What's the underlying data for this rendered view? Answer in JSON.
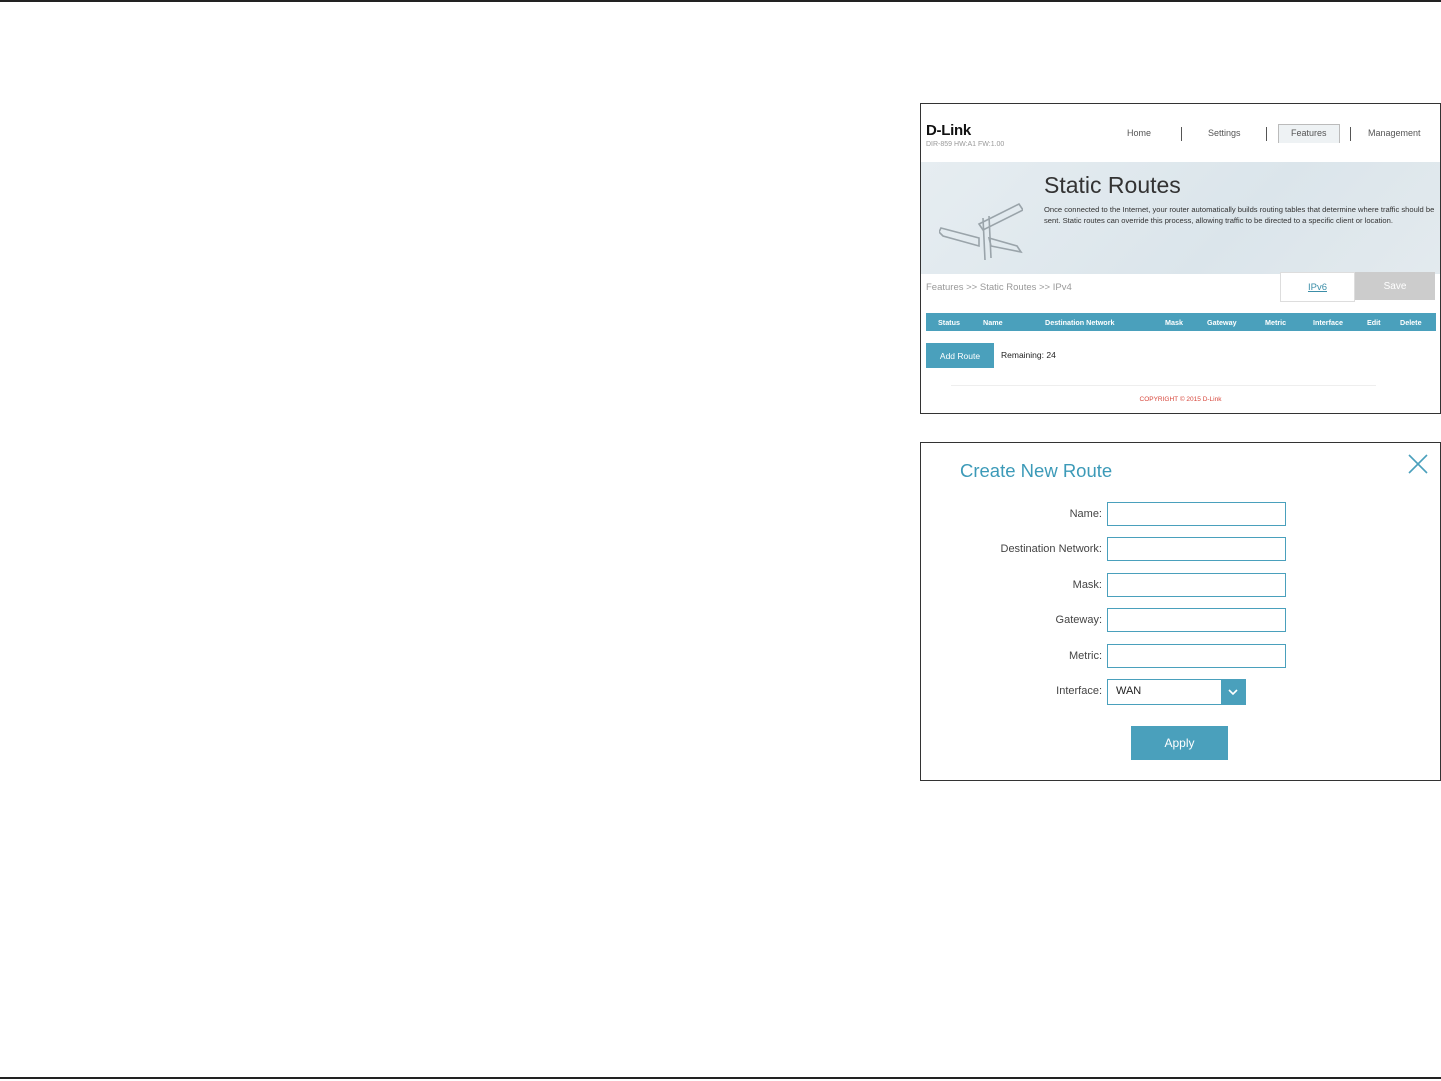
{
  "router_page": {
    "logo": "D-Link",
    "model": "DIR-859 HW:A1 FW:1.00",
    "nav": {
      "home": "Home",
      "settings": "Settings",
      "features": "Features",
      "management": "Management"
    },
    "title": "Static Routes",
    "description": "Once connected to the Internet, your router automatically builds routing tables that determine where traffic should be sent. Static routes can override this process, allowing traffic to be directed to a specific client or location.",
    "breadcrumb": "Features >> Static Routes >> IPv4",
    "ipv6_label": "IPv6",
    "save_label": "Save",
    "table_headers": [
      "Status",
      "Name",
      "Destination Network",
      "Mask",
      "Gateway",
      "Metric",
      "Interface",
      "Edit",
      "Delete"
    ],
    "add_route_label": "Add Route",
    "remaining": "Remaining: 24",
    "copyright": "COPYRIGHT © 2015 D-Link"
  },
  "dialog": {
    "title": "Create New Route",
    "fields": {
      "name": {
        "label": "Name:",
        "value": ""
      },
      "destination": {
        "label": "Destination Network:",
        "value": ""
      },
      "mask": {
        "label": "Mask:",
        "value": ""
      },
      "gateway": {
        "label": "Gateway:",
        "value": ""
      },
      "metric": {
        "label": "Metric:",
        "value": ""
      }
    },
    "interface": {
      "label": "Interface:",
      "value": "WAN"
    },
    "apply_label": "Apply"
  },
  "colors": {
    "accent": "#4aa0bc",
    "title_blue": "#3c9ab8",
    "save_disabled": "#cccccc",
    "copyright": "#d7463b"
  },
  "icons": {
    "close": "close-icon",
    "dropdown": "chevron-down-icon",
    "signpost": "signpost-icon"
  }
}
